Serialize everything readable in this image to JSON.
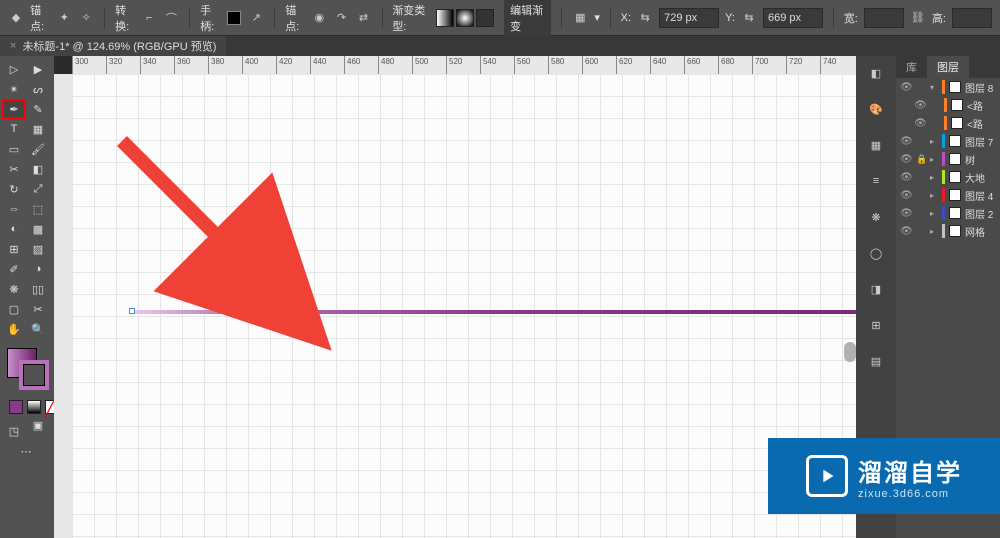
{
  "options": {
    "anchor_label": "锚点:",
    "convert_label": "转换:",
    "handle_label": "手柄:",
    "anchor2_label": "锚点:",
    "gradient_type_label": "渐变类型:",
    "edit_gradient_label": "编辑渐变",
    "x_label": "X:",
    "x_value": "729 px",
    "y_label": "Y:",
    "y_value": "669 px",
    "w_label": "宽:",
    "w_value": "",
    "h_label": "高:",
    "h_value": ""
  },
  "tab": {
    "title": "未标题-1* @ 124.69% (RGB/GPU 预览)",
    "close": "×"
  },
  "ruler_ticks": [
    300,
    320,
    340,
    360,
    380,
    400,
    420,
    440,
    460,
    480,
    500,
    520,
    540,
    560,
    580,
    600,
    620,
    640,
    660,
    680,
    700,
    720,
    740
  ],
  "panel": {
    "lib_tab": "库",
    "layers_tab": "图层"
  },
  "layers": [
    {
      "name": "图层 8",
      "color": "#ff7f27",
      "expanded": true,
      "sub": [
        {
          "name": "<路",
          "color": "#ff7f27"
        },
        {
          "name": "<路",
          "color": "#ff7f27"
        }
      ]
    },
    {
      "name": "图层 7",
      "color": "#00a2e8"
    },
    {
      "name": "树",
      "color": "#b94fb9",
      "locked": true
    },
    {
      "name": "大地",
      "color": "#b5e61d"
    },
    {
      "name": "图层 4",
      "color": "#ed1c24"
    },
    {
      "name": "图层 2",
      "color": "#3f48cc"
    },
    {
      "name": "网格",
      "color": "#c3c3c3"
    }
  ],
  "watermark": {
    "title": "溜溜自学",
    "url": "zixue.3d66.com"
  },
  "colors": {
    "accent": "#8a3a8a",
    "highlight_red": "#ff0000"
  }
}
